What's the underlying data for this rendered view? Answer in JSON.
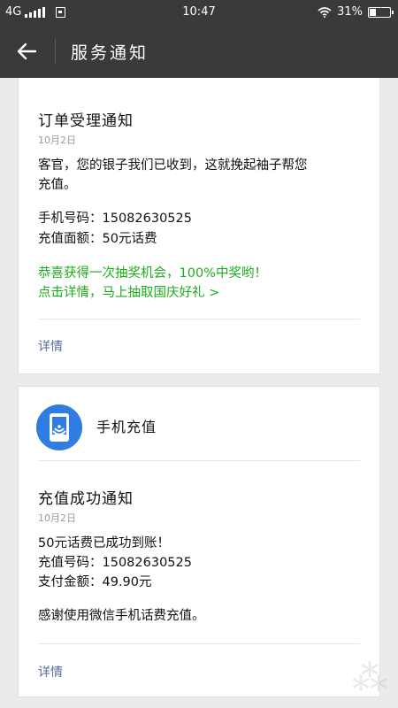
{
  "status_bar": {
    "network": "4G",
    "time": "10:47",
    "battery_text": "31%",
    "battery_level": 0.31,
    "icons": [
      "signal-icon",
      "notification-icon",
      "wifi-icon",
      "battery-icon"
    ]
  },
  "header": {
    "title": "服务通知"
  },
  "notice1": {
    "title": "订单受理通知",
    "date": "10月2日",
    "lines": [
      "客官，您的银子我们已收到，这就挽起袖子帮您",
      "充值。",
      "手机号码：15082630525",
      "充值面额：50元话费",
      "恭喜获得一次抽奖机会，100%中奖哟！",
      "点击详情，马上抽取国庆好礼 >"
    ],
    "details_label": "详情"
  },
  "notice2": {
    "app_name": "手机充值",
    "title": "充值成功通知",
    "date": "10月2日",
    "lines": [
      "50元话费已成功到账！",
      "充值号码：15082630525",
      "支付金额：49.90元",
      "感谢使用微信手机话费充值。"
    ],
    "details_label": "详情"
  },
  "colors": {
    "header_bg": "#3a3a3c",
    "highlight_green": "#1aad19",
    "link_blue": "#576b95",
    "app_logo_blue": "#2f7ce3"
  }
}
